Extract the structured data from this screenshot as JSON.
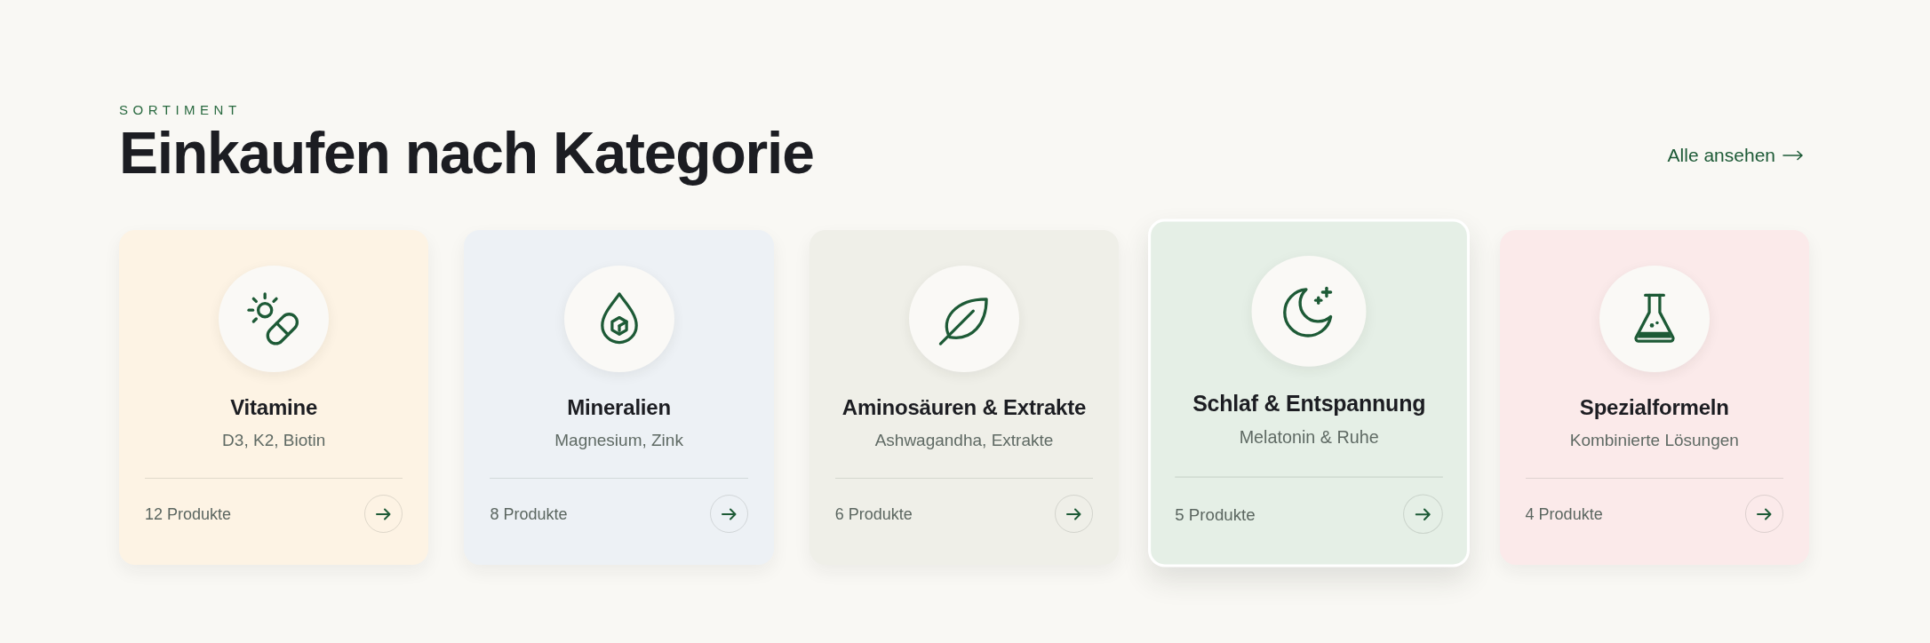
{
  "section": {
    "eyebrow": "SORTIMENT",
    "title": "Einkaufen nach Kategorie",
    "view_all": {
      "label": "Alle ansehen"
    }
  },
  "categories": [
    {
      "name": "Vitamine",
      "description": "D3, K2, Biotin",
      "count": "12 Produkte",
      "color": "#fdf3e4",
      "selected": false
    },
    {
      "name": "Mineralien",
      "description": "Magnesium, Zink",
      "count": "8 Produkte",
      "color": "#edf1f5",
      "selected": false
    },
    {
      "name": "Aminosäuren & Extrakte",
      "description": "Ashwagandha, Extrakte",
      "count": "6 Produkte",
      "color": "#efefe8",
      "selected": false
    },
    {
      "name": "Schlaf & Entspannung",
      "description": "Melatonin & Ruhe",
      "count": "5 Produkte",
      "color": "#e5efe6",
      "selected": true
    },
    {
      "name": "Spezialformeln",
      "description": "Kombinierte Lösungen",
      "count": "4 Produkte",
      "color": "#fbeaea",
      "selected": false
    }
  ]
}
